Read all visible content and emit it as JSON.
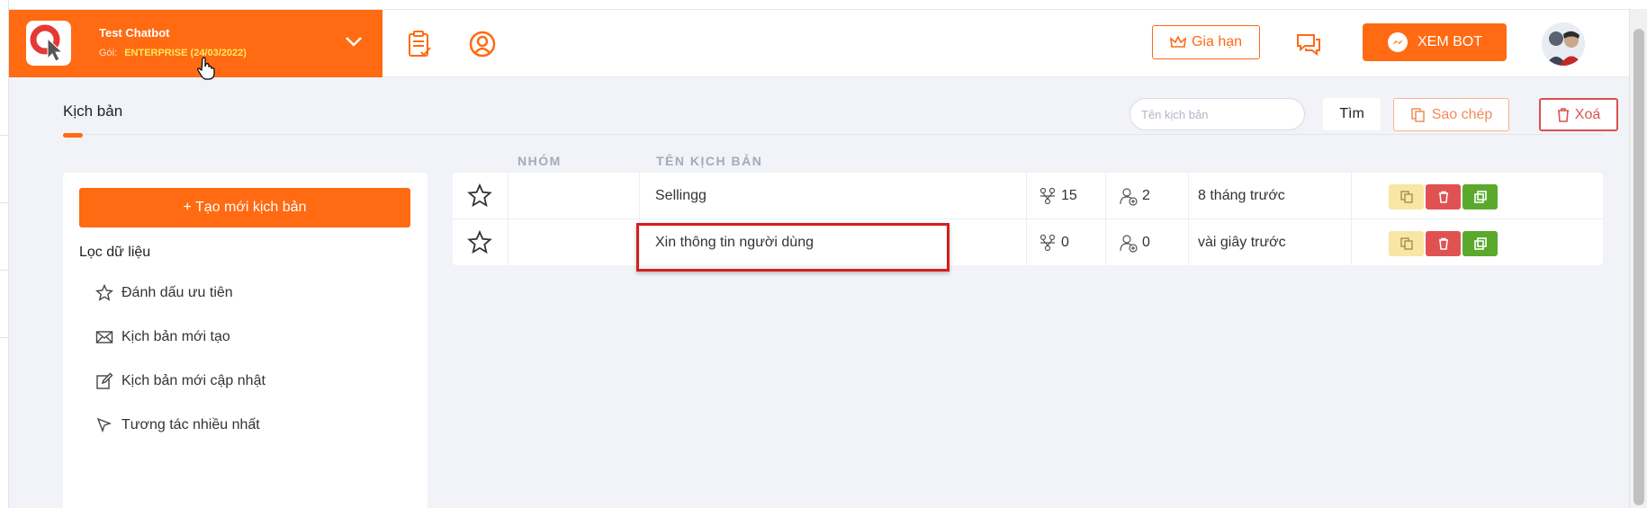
{
  "header": {
    "bot_name": "Test Chatbot",
    "plan_label": "Gói:",
    "plan_value": "ENTERPRISE (24/03/2022)",
    "renew_label": "Gia hạn",
    "view_bot_label": "XEM BOT"
  },
  "page": {
    "title": "Kịch bản",
    "search_placeholder": "Tên kịch bản",
    "find_label": "Tìm",
    "copy_label": "Sao chép",
    "delete_label": "Xoá"
  },
  "sidebar": {
    "create_label": "+ Tạo mới kịch bản",
    "filter_title": "Lọc dữ liệu",
    "filters": [
      {
        "label": "Đánh dấu ưu tiên",
        "icon": "star-icon"
      },
      {
        "label": "Kịch bản mới tạo",
        "icon": "envelope-icon"
      },
      {
        "label": "Kịch bản mới cập nhật",
        "icon": "edit-icon"
      },
      {
        "label": "Tương tác nhiều nhất",
        "icon": "pointer-icon"
      }
    ]
  },
  "table": {
    "columns": [
      "NHÓM",
      "TÊN KỊCH BẢN"
    ],
    "rows": [
      {
        "group": "",
        "name": "Sellingg",
        "interactions": "15",
        "users": "2",
        "updated": "8 tháng trước"
      },
      {
        "group": "",
        "name": "Xin thông tin người dùng",
        "interactions": "0",
        "users": "0",
        "updated": "vài giây trước"
      }
    ]
  },
  "colors": {
    "accent": "#ff6a13",
    "copy_action": "#f7e6a4",
    "delete_action": "#e05252",
    "open_action": "#5aa92d",
    "highlight_border": "#d21f1f"
  }
}
